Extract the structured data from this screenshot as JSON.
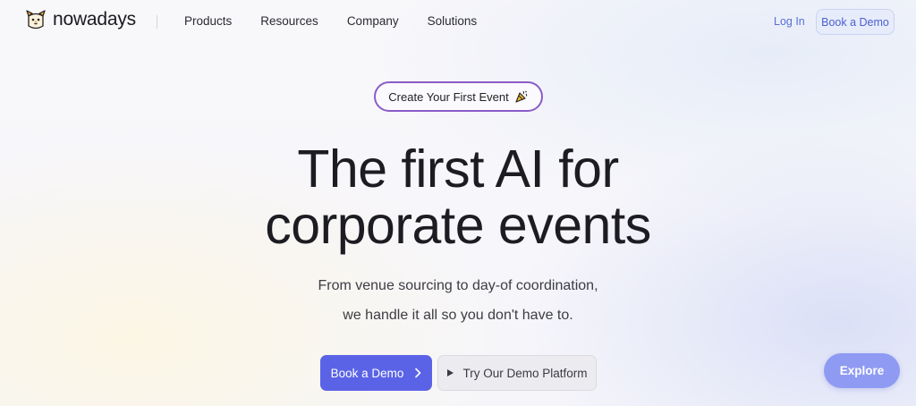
{
  "brand": {
    "name": "nowadays",
    "logo_icon": "dog-logo-icon"
  },
  "nav": {
    "links": [
      "Products",
      "Resources",
      "Company",
      "Solutions"
    ],
    "login_label": "Log In",
    "demo_label": "Book a Demo"
  },
  "hero": {
    "pill_label": "Create Your First Event",
    "pill_icon": "party-popper-icon",
    "headline_line1": "The first AI for",
    "headline_line2": "corporate events",
    "sub_line1": "From venue sourcing to day-of coordination,",
    "sub_line2": "we handle it all so you don't have to.",
    "primary_cta": "Book a Demo",
    "secondary_cta": "Try Our Demo Platform"
  },
  "explore_label": "Explore",
  "colors": {
    "accent": "#5a63e6",
    "link": "#5b6fd6",
    "pill_border": "#8a5cc8",
    "explore": "#8f9bf2"
  }
}
